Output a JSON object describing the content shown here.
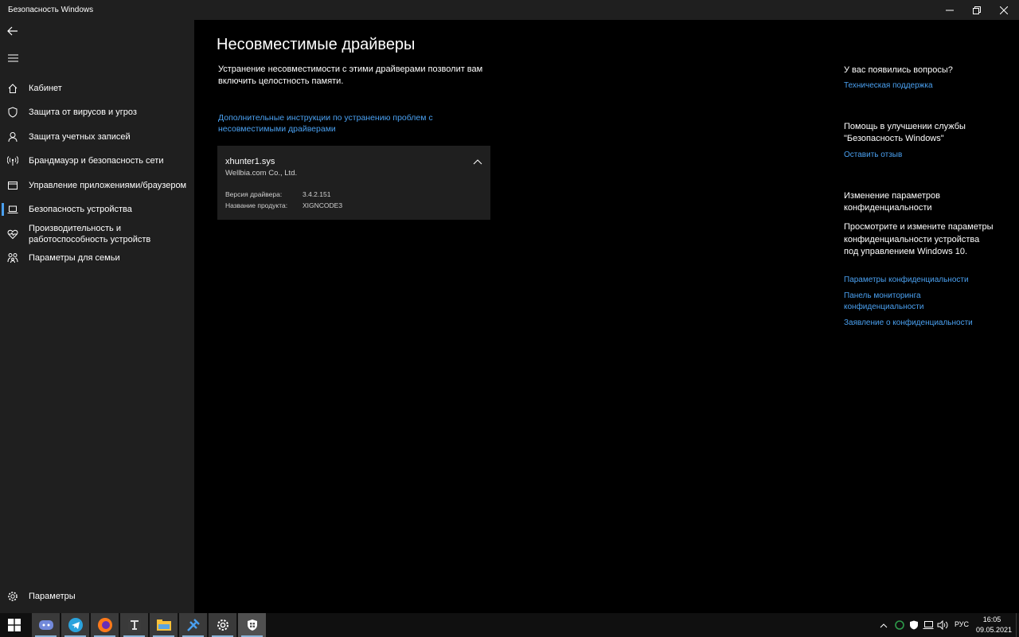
{
  "window": {
    "title": "Безопасность Windows"
  },
  "sidebar": {
    "items": [
      {
        "label": "Кабинет",
        "icon": "home-icon"
      },
      {
        "label": "Защита от вирусов и угроз",
        "icon": "shield-icon"
      },
      {
        "label": "Защита учетных записей",
        "icon": "person-icon"
      },
      {
        "label": "Брандмауэр и безопасность сети",
        "icon": "wifi-antenna-icon"
      },
      {
        "label": "Управление приложениями/браузером",
        "icon": "app-window-icon"
      },
      {
        "label": "Безопасность устройства",
        "icon": "laptop-icon",
        "active": true
      },
      {
        "label": "Производительность и работоспособность устройств",
        "icon": "heart-pulse-icon"
      },
      {
        "label": "Параметры для семьи",
        "icon": "family-icon"
      }
    ],
    "settings_label": "Параметры"
  },
  "main": {
    "title": "Несовместимые драйверы",
    "description": "Устранение несовместимости с этими драйверами позволит вам включить целостность памяти.",
    "help_link": "Дополнительные инструкции по устранению проблем с несовместимыми драйверами",
    "driver": {
      "name": "xhunter1.sys",
      "vendor": "Wellbia.com Co., Ltd.",
      "version_label": "Версия драйвера:",
      "version_value": "3.4.2.151",
      "product_label": "Название продукта:",
      "product_value": "XIGNCODE3"
    }
  },
  "right_column": {
    "questions_heading": "У вас появились вопросы?",
    "support_link": "Техническая поддержка",
    "improve_heading": "Помощь в улучшении службы \"Безопасность Windows\"",
    "feedback_link": "Оставить отзыв",
    "privacy_heading": "Изменение параметров конфиденциальности",
    "privacy_text": "Просмотрите и измените параметры конфиденциальности устройства под управлением Windows 10.",
    "privacy_settings_link": "Параметры конфиденциальности",
    "privacy_dashboard_link": "Панель мониторинга конфиденциальности",
    "privacy_statement_link": "Заявление о конфиденциальности"
  },
  "taskbar": {
    "apps": [
      "discord-icon",
      "telegram-icon",
      "firefox-icon",
      "world-of-tanks-icon",
      "file-explorer-icon",
      "tool-icon",
      "settings-gear-icon",
      "windows-security-icon"
    ],
    "language": "РУС",
    "time": "16:05",
    "date": "09.05.2021"
  },
  "colors": {
    "accent": "#4aa0f0",
    "sidebar_bg": "#1f1f1f",
    "main_bg": "#000000"
  }
}
